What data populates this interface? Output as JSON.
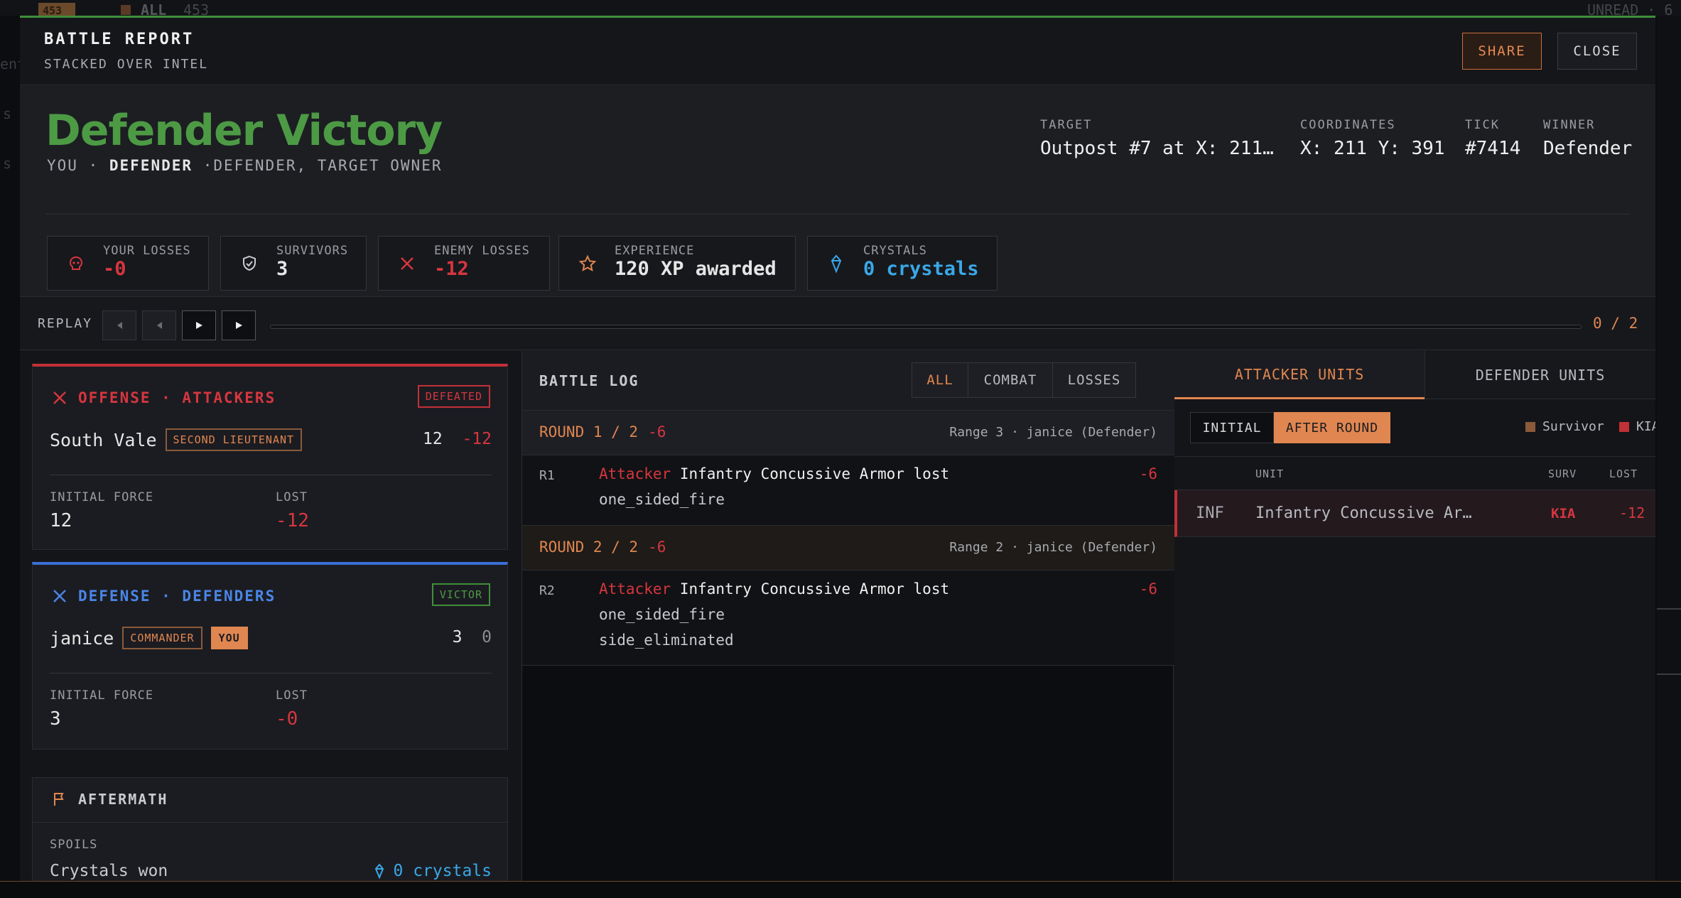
{
  "background": {
    "badge": "453",
    "all_label": "ALL",
    "all_count": "453",
    "unread_label": "UNREAD · 6",
    "side_frags": [
      "ent",
      "s",
      "s"
    ]
  },
  "header": {
    "title": "BATTLE REPORT",
    "subtitle": "STACKED OVER INTEL",
    "share": "SHARE",
    "close": "CLOSE"
  },
  "summary": {
    "result": "Defender Victory",
    "you": "YOU ·",
    "role": "DEFENDER",
    "role_note": "·DEFENDER, TARGET OWNER",
    "target_label": "TARGET",
    "target": "Outpost #7 at X: 211…",
    "coords_label": "COORDINATES",
    "coords": "X: 211 Y: 391",
    "tick_label": "TICK",
    "tick": "#7414",
    "winner_label": "WINNER",
    "winner": "Defender"
  },
  "stats": [
    {
      "label": "YOUR LOSSES",
      "value": "-0",
      "icon": "skull-icon"
    },
    {
      "label": "SURVIVORS",
      "value": "3",
      "icon": "shield-icon"
    },
    {
      "label": "ENEMY LOSSES",
      "value": "-12",
      "icon": "crossed-swords-icon"
    },
    {
      "label": "EXPERIENCE",
      "value": "120 XP awarded",
      "icon": "star-icon"
    },
    {
      "label": "CRYSTALS",
      "value": "0 crystals",
      "icon": "crystal-icon"
    }
  ],
  "replay": {
    "label": "REPLAY",
    "counter": "0 / 2",
    "progress": 0
  },
  "offense": {
    "title": "OFFENSE · ATTACKERS",
    "status": "DEFEATED",
    "name": "South Vale",
    "rank": "SECOND LIEUTENANT",
    "count": "12",
    "loss": "-12",
    "initial_label": "INITIAL FORCE",
    "initial": "12",
    "lost_label": "LOST",
    "lost": "-12"
  },
  "defense": {
    "title": "DEFENSE · DEFENDERS",
    "status": "VICTOR",
    "name": "janice",
    "rank": "COMMANDER",
    "you": "YOU",
    "count": "3",
    "loss": "0",
    "initial_label": "INITIAL FORCE",
    "initial": "3",
    "lost_label": "LOST",
    "lost": "-0"
  },
  "aftermath": {
    "title": "AFTERMATH",
    "spoils_label": "SPOILS",
    "crystals_label": "Crystals won",
    "crystals": "0 crystals"
  },
  "log": {
    "title": "BATTLE LOG",
    "filters": [
      "ALL",
      "COMBAT",
      "LOSSES"
    ],
    "rounds": [
      {
        "title": "ROUND 1 / 2",
        "delta": "-6",
        "range": "Range 3 · janice (Defender)",
        "id": "R1",
        "actor": "Attacker",
        "event": "Infantry Concussive Armor lost",
        "notes": [
          "one_sided_fire"
        ],
        "dmg": "-6"
      },
      {
        "title": "ROUND 2 / 2",
        "delta": "-6",
        "range": "Range 2 · janice (Defender)",
        "id": "R2",
        "actor": "Attacker",
        "event": "Infantry Concussive Armor lost",
        "notes": [
          "one_sided_fire",
          "side_eliminated"
        ],
        "dmg": "-6"
      }
    ]
  },
  "units": {
    "tabs": [
      "ATTACKER UNITS",
      "DEFENDER UNITS"
    ],
    "toggles": [
      "INITIAL",
      "AFTER ROUND"
    ],
    "legend": [
      {
        "label": "Survivor",
        "color": "#8a5a3a"
      },
      {
        "label": "KIA",
        "color": "#c23038"
      }
    ],
    "columns": [
      "UNIT",
      "SURV",
      "LOST"
    ],
    "rows": [
      {
        "code": "INF",
        "name": "Infantry Concussive Ar…",
        "surv": "KIA",
        "lost": "-12"
      }
    ]
  }
}
